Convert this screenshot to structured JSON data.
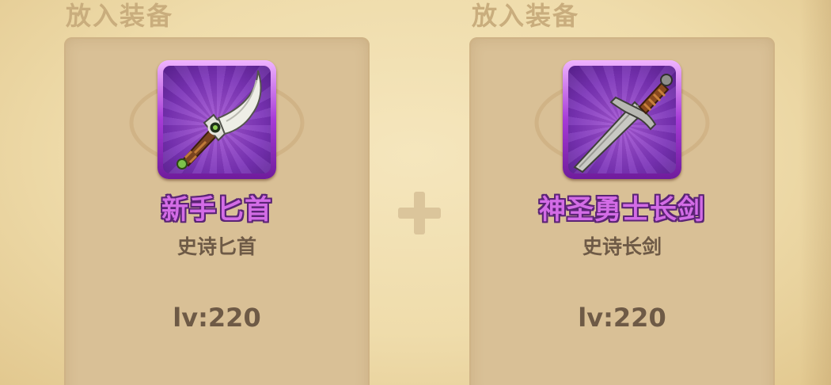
{
  "slots": [
    {
      "title": "放入装备",
      "item_name": "新手匕首",
      "item_type": "史诗匕首",
      "level": "lv:220",
      "icon": "dagger-icon",
      "rarity_color": "#a63bd6"
    },
    {
      "title": "放入装备",
      "item_name": "神圣勇士长剑",
      "item_type": "史诗长剑",
      "level": "lv:220",
      "icon": "longsword-icon",
      "rarity_color": "#a63bd6"
    }
  ],
  "combine_icon": "plus-icon"
}
